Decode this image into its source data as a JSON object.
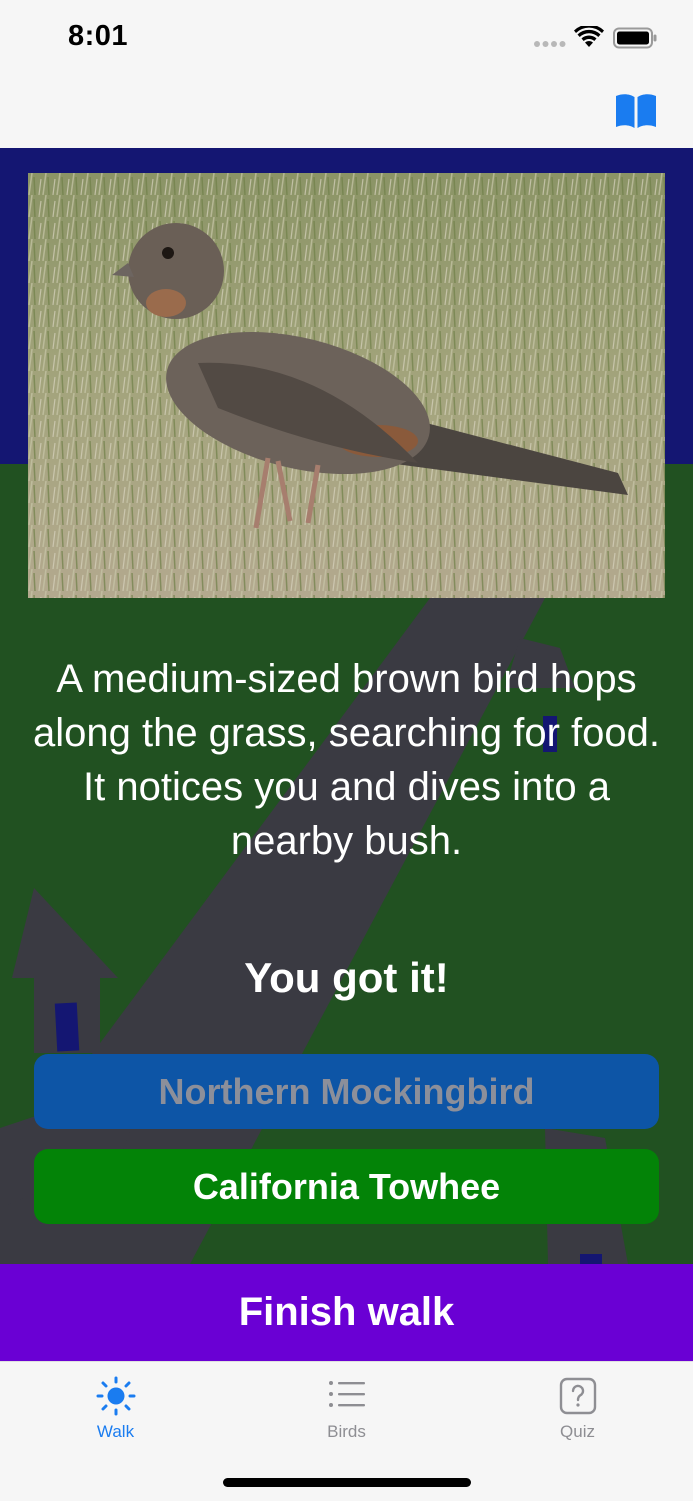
{
  "status_bar": {
    "time": "8:01"
  },
  "colors": {
    "sky": "#141672",
    "grass": "#215121",
    "path": "#3a3a42",
    "accent_blue": "#1a7cf0",
    "wrong_choice_bg": "#0d55a6",
    "right_choice_bg": "#038307",
    "finish_bg": "#6a00d4"
  },
  "nav": {
    "book_icon": "book-open-icon"
  },
  "encounter": {
    "photo_subject": "bird-photo",
    "description": "A medium-sized brown bird hops along the grass, searching for food. It notices you and dives into a nearby bush.",
    "result": "You got it!"
  },
  "choices": [
    {
      "label": "Northern Mockingbird",
      "state": "wrong"
    },
    {
      "label": "California Towhee",
      "state": "correct"
    }
  ],
  "finish_label": "Finish walk",
  "tabs": [
    {
      "label": "Walk",
      "icon": "sun-icon",
      "selected": true
    },
    {
      "label": "Birds",
      "icon": "list-icon",
      "selected": false
    },
    {
      "label": "Quiz",
      "icon": "question-box-icon",
      "selected": false
    }
  ]
}
